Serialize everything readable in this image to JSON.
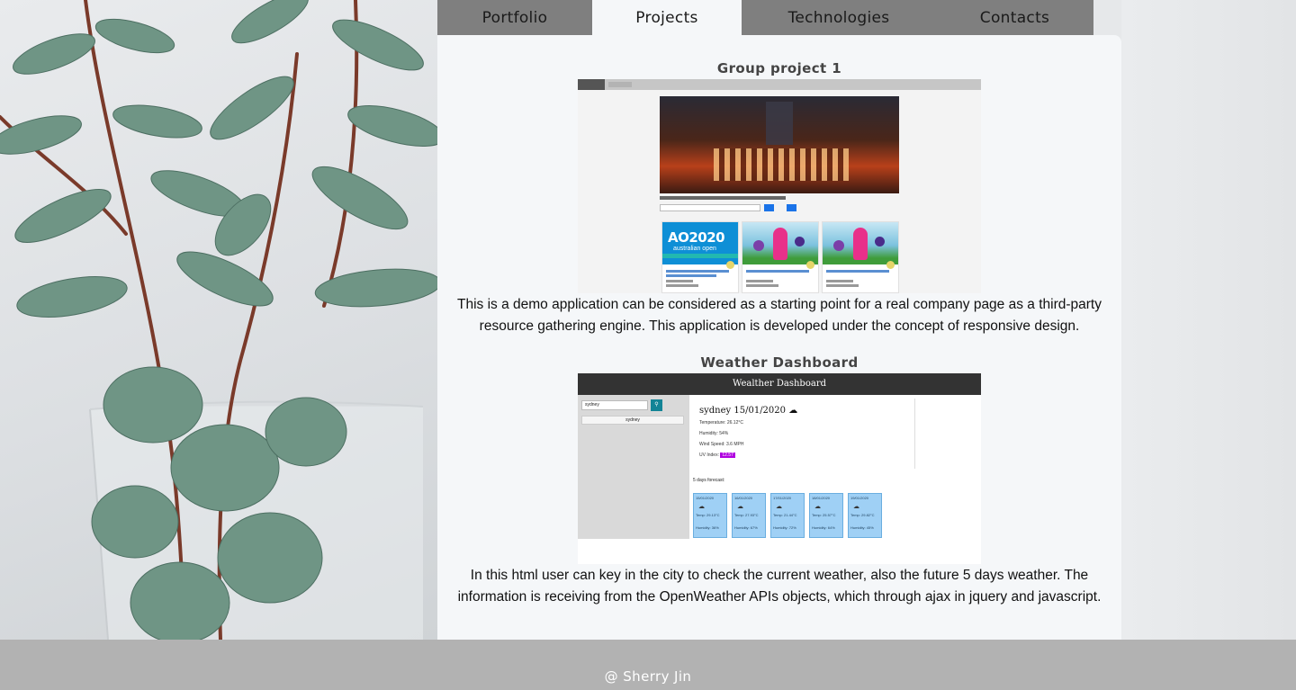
{
  "nav": {
    "tabs": [
      {
        "label": "Portfolio",
        "active": false
      },
      {
        "label": "Projects",
        "active": true
      },
      {
        "label": "Technologies",
        "active": false
      },
      {
        "label": "Contacts",
        "active": false
      }
    ]
  },
  "projects": [
    {
      "title": "Group project 1",
      "description": "This is a demo application can be considered as a starting point for a real company page as a third-party resource gathering engine. This application is developed under the concept of responsive design.",
      "screenshot": {
        "hero_caption": "Learning for amazing events keyword in the best",
        "search_value": "music",
        "cards": [
          {
            "image": "ao2020",
            "badge": "AO2020",
            "badge_sub": "australian open"
          },
          {
            "image": "festival"
          },
          {
            "image": "festival"
          }
        ]
      }
    },
    {
      "title": "Weather Dashboard",
      "description": "In this html user can key in the city to check the current weather, also the future 5 days weather. The information is receiving from the OpenWeather APIs objects, which through ajax in jquery and javascript.",
      "screenshot": {
        "header": "Wealther Dashboard",
        "search_value": "sydney",
        "search_icon": "search-icon",
        "history_item": "sydney",
        "current": {
          "heading": "sydney 15/01/2020",
          "icon": "cloud-icon",
          "temperature": "Temperature: 26.12°C",
          "humidity": "Humidity: 54%",
          "wind": "Wind Speed: 3.6 MPH",
          "uv_label": "UV Index:",
          "uv_value": "12.57"
        },
        "forecast_title": "5 days forecast:",
        "forecast": [
          {
            "date": "15/01/2020",
            "temp": "Temp: 29.13°C",
            "humidity": "Humidity: 36%"
          },
          {
            "date": "16/01/2020",
            "temp": "Temp: 27.93°C",
            "humidity": "Humidity: 67%"
          },
          {
            "date": "17/01/2020",
            "temp": "Temp: 21.44°C",
            "humidity": "Humidity: 72%"
          },
          {
            "date": "18/01/2020",
            "temp": "Temp: 25.57°C",
            "humidity": "Humidity: 64%"
          },
          {
            "date": "19/01/2020",
            "temp": "Temp: 29.82°C",
            "humidity": "Humidity: 45%"
          }
        ]
      }
    }
  ],
  "footer": {
    "text": "@ Sherry Jin"
  },
  "colors": {
    "tab_bar": "#7f7f7f",
    "panel": "#f5f7f9",
    "footer": "#b2b2b2"
  }
}
